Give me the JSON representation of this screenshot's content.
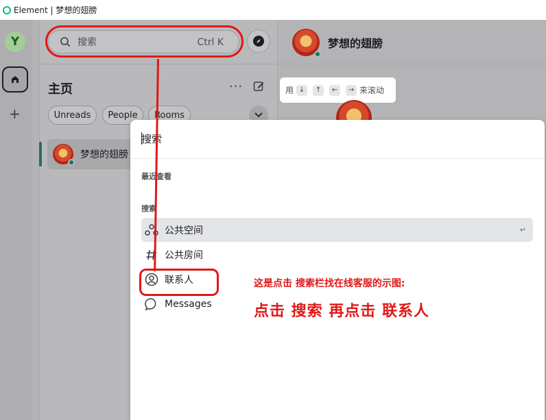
{
  "window": {
    "title": "Element | 梦想的翅膀"
  },
  "spacebar": {
    "avatar_initial": "Y",
    "add_label": "+"
  },
  "left_panel": {
    "search": {
      "placeholder": "搜索",
      "shortcut": "Ctrl K"
    },
    "title": "主页",
    "more_label": "···",
    "filters": [
      "Unreads",
      "People",
      "Rooms"
    ],
    "rooms": [
      {
        "name": "梦想的翅膀"
      }
    ]
  },
  "room": {
    "name": "梦想的翅膀",
    "hint": {
      "prefix": "用",
      "keys": [
        "↓",
        "↑",
        "←",
        "→"
      ],
      "suffix": "来滚动"
    }
  },
  "dialog": {
    "search_placeholder": "搜索",
    "recent_label": "最近查看",
    "search_section_label": "搜索",
    "options": [
      {
        "label": "公共空间",
        "icon": "spaces-icon",
        "active": true
      },
      {
        "label": "公共房间",
        "icon": "hash-icon",
        "active": false
      },
      {
        "label": "联系人",
        "icon": "user-icon",
        "active": false
      },
      {
        "label": "Messages",
        "icon": "chat-bubble-icon",
        "active": false
      }
    ],
    "enter_glyph": "↵"
  },
  "annotations": {
    "line1": "这是点击 搜索栏找在线客服的示图:",
    "line2": "点击 搜索  再点击 联系人",
    "color": "#e01818"
  },
  "colors": {
    "online": "#0b7a58",
    "accent_green": "#0dbd8b"
  }
}
